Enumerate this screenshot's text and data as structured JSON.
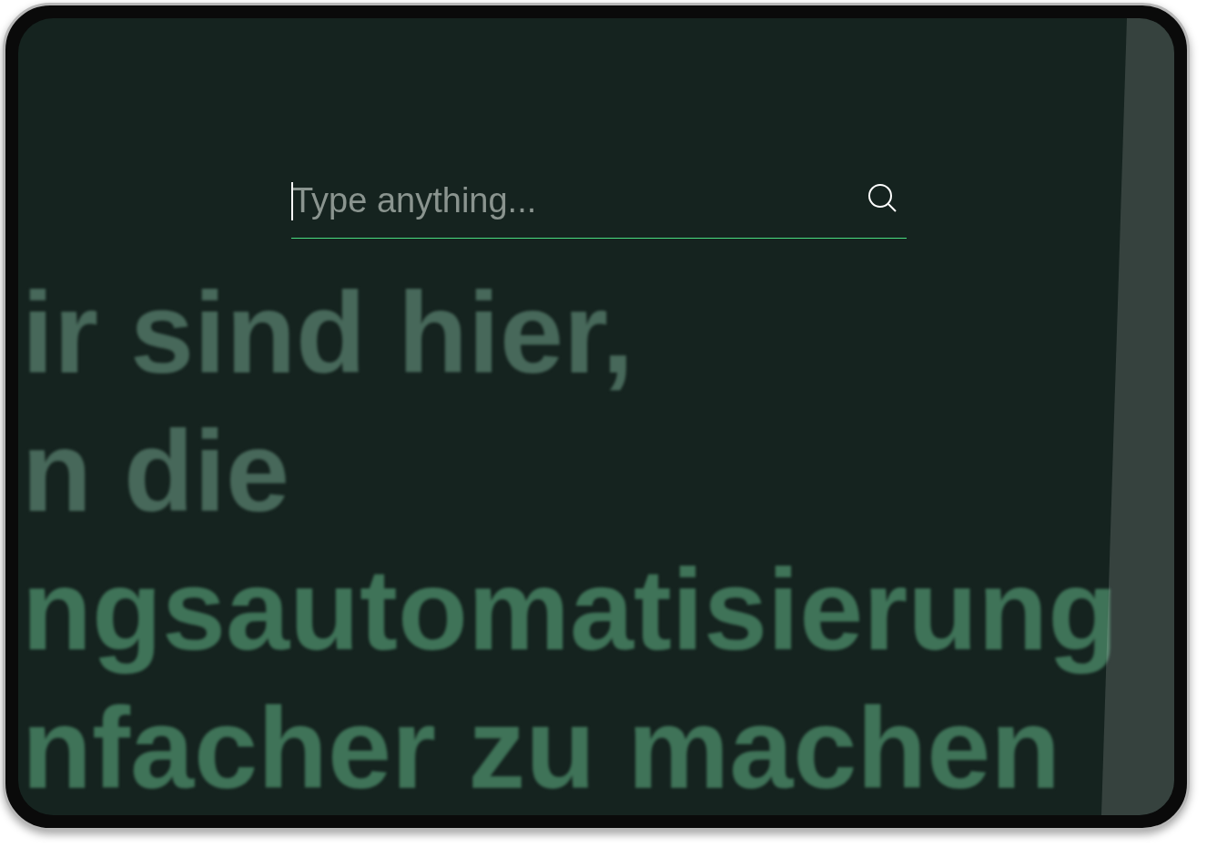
{
  "search": {
    "placeholder": "Type anything..."
  },
  "background_text": [
    "ir sind hier,",
    "n die",
    "ngsautomatisierung",
    "nfacher zu machen"
  ]
}
